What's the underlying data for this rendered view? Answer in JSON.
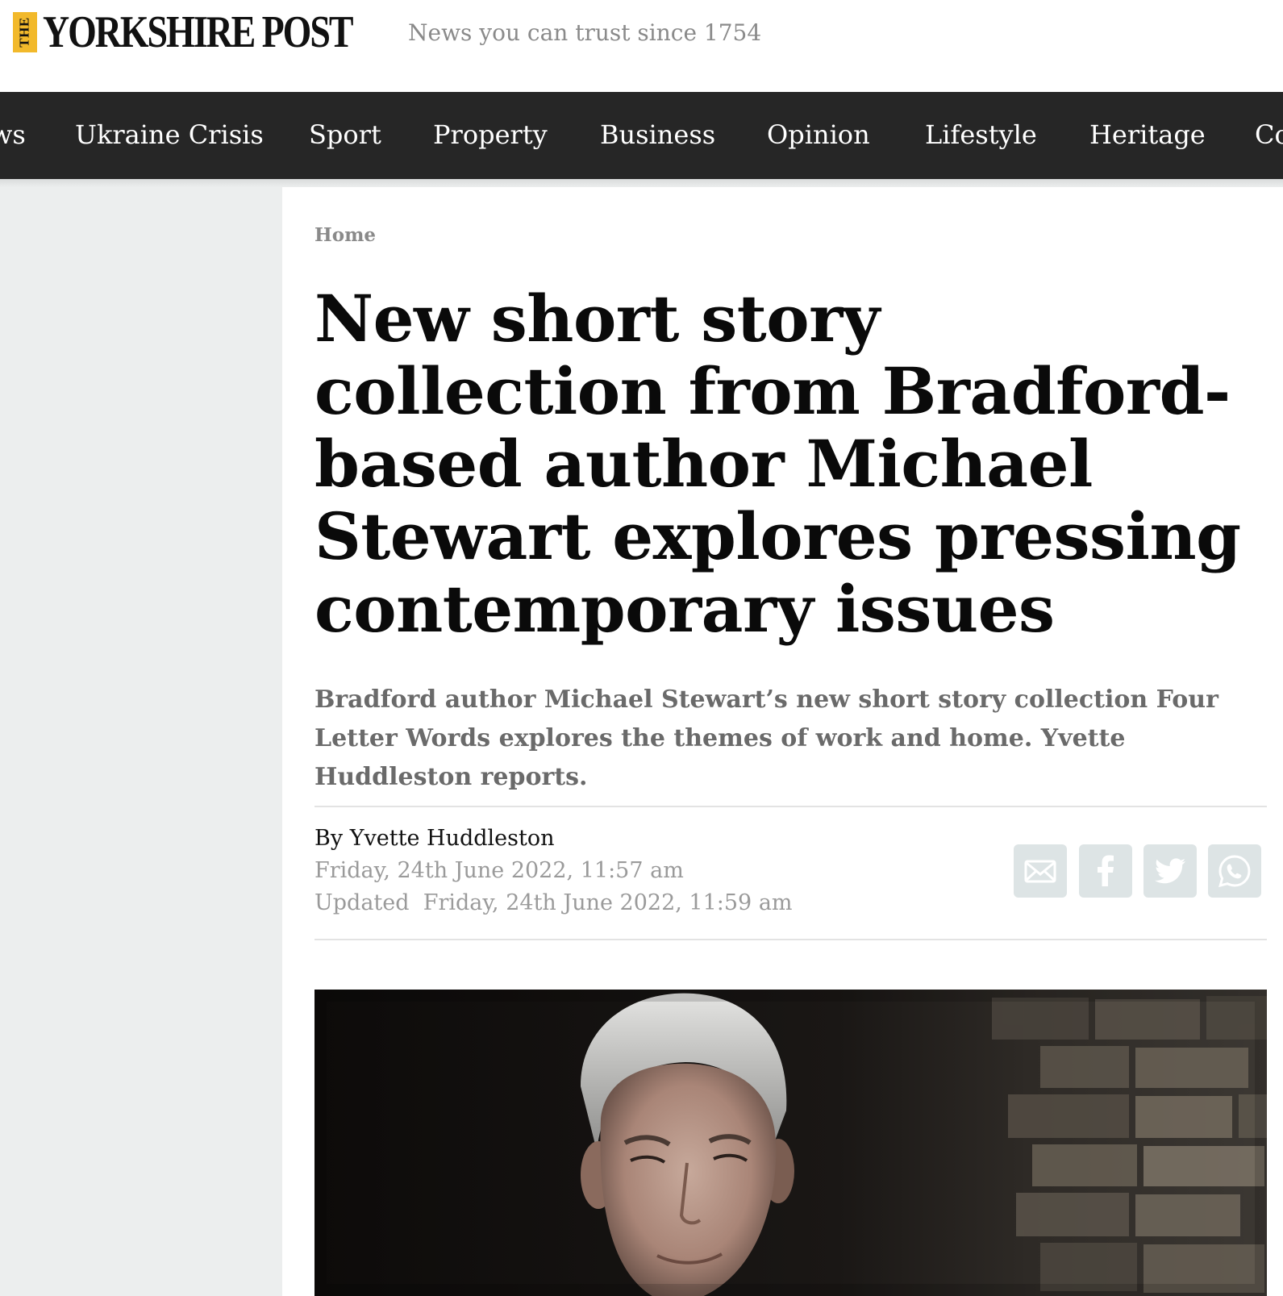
{
  "header": {
    "logo_the": "THE",
    "logo_name": "YORKSHIRE POST",
    "tagline": "News you can trust since 1754"
  },
  "nav": {
    "items": [
      "ws",
      "Ukraine Crisis",
      "Sport",
      "Property",
      "Business",
      "Opinion",
      "Lifestyle",
      "Heritage",
      "Co"
    ]
  },
  "article": {
    "breadcrumb": "Home",
    "headline": "New short story collection from Bradford-based author Michael Stewart explores pressing contemporary issues",
    "standfirst": "Bradford author Michael Stewart’s new short story collection Four Letter Words explores the themes of work and home. Yvette Huddleston reports.",
    "byline_prefix": "By",
    "author": "Yvette Huddleston",
    "published": "Friday, 24th June 2022, 11:57 am",
    "updated_label": "Updated",
    "updated": "Friday, 24th June 2022, 11:59 am"
  },
  "share": {
    "icons": [
      "email-icon",
      "facebook-icon",
      "twitter-icon",
      "whatsapp-icon"
    ],
    "color": "#dde4e5"
  },
  "colors": {
    "nav_bg": "#262626",
    "logo_accent": "#f2b92b",
    "rail_bg": "#eceeee"
  }
}
